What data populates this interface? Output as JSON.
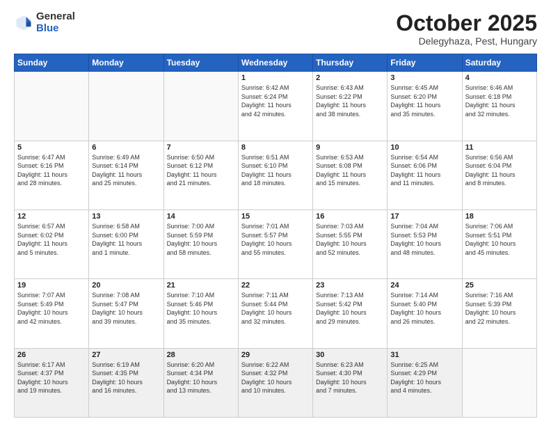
{
  "header": {
    "logo_general": "General",
    "logo_blue": "Blue",
    "month_title": "October 2025",
    "location": "Delegyhaza, Pest, Hungary"
  },
  "weekdays": [
    "Sunday",
    "Monday",
    "Tuesday",
    "Wednesday",
    "Thursday",
    "Friday",
    "Saturday"
  ],
  "weeks": [
    [
      {
        "day": "",
        "info": ""
      },
      {
        "day": "",
        "info": ""
      },
      {
        "day": "",
        "info": ""
      },
      {
        "day": "1",
        "info": "Sunrise: 6:42 AM\nSunset: 6:24 PM\nDaylight: 11 hours\nand 42 minutes."
      },
      {
        "day": "2",
        "info": "Sunrise: 6:43 AM\nSunset: 6:22 PM\nDaylight: 11 hours\nand 38 minutes."
      },
      {
        "day": "3",
        "info": "Sunrise: 6:45 AM\nSunset: 6:20 PM\nDaylight: 11 hours\nand 35 minutes."
      },
      {
        "day": "4",
        "info": "Sunrise: 6:46 AM\nSunset: 6:18 PM\nDaylight: 11 hours\nand 32 minutes."
      }
    ],
    [
      {
        "day": "5",
        "info": "Sunrise: 6:47 AM\nSunset: 6:16 PM\nDaylight: 11 hours\nand 28 minutes."
      },
      {
        "day": "6",
        "info": "Sunrise: 6:49 AM\nSunset: 6:14 PM\nDaylight: 11 hours\nand 25 minutes."
      },
      {
        "day": "7",
        "info": "Sunrise: 6:50 AM\nSunset: 6:12 PM\nDaylight: 11 hours\nand 21 minutes."
      },
      {
        "day": "8",
        "info": "Sunrise: 6:51 AM\nSunset: 6:10 PM\nDaylight: 11 hours\nand 18 minutes."
      },
      {
        "day": "9",
        "info": "Sunrise: 6:53 AM\nSunset: 6:08 PM\nDaylight: 11 hours\nand 15 minutes."
      },
      {
        "day": "10",
        "info": "Sunrise: 6:54 AM\nSunset: 6:06 PM\nDaylight: 11 hours\nand 11 minutes."
      },
      {
        "day": "11",
        "info": "Sunrise: 6:56 AM\nSunset: 6:04 PM\nDaylight: 11 hours\nand 8 minutes."
      }
    ],
    [
      {
        "day": "12",
        "info": "Sunrise: 6:57 AM\nSunset: 6:02 PM\nDaylight: 11 hours\nand 5 minutes."
      },
      {
        "day": "13",
        "info": "Sunrise: 6:58 AM\nSunset: 6:00 PM\nDaylight: 11 hours\nand 1 minute."
      },
      {
        "day": "14",
        "info": "Sunrise: 7:00 AM\nSunset: 5:59 PM\nDaylight: 10 hours\nand 58 minutes."
      },
      {
        "day": "15",
        "info": "Sunrise: 7:01 AM\nSunset: 5:57 PM\nDaylight: 10 hours\nand 55 minutes."
      },
      {
        "day": "16",
        "info": "Sunrise: 7:03 AM\nSunset: 5:55 PM\nDaylight: 10 hours\nand 52 minutes."
      },
      {
        "day": "17",
        "info": "Sunrise: 7:04 AM\nSunset: 5:53 PM\nDaylight: 10 hours\nand 48 minutes."
      },
      {
        "day": "18",
        "info": "Sunrise: 7:06 AM\nSunset: 5:51 PM\nDaylight: 10 hours\nand 45 minutes."
      }
    ],
    [
      {
        "day": "19",
        "info": "Sunrise: 7:07 AM\nSunset: 5:49 PM\nDaylight: 10 hours\nand 42 minutes."
      },
      {
        "day": "20",
        "info": "Sunrise: 7:08 AM\nSunset: 5:47 PM\nDaylight: 10 hours\nand 39 minutes."
      },
      {
        "day": "21",
        "info": "Sunrise: 7:10 AM\nSunset: 5:46 PM\nDaylight: 10 hours\nand 35 minutes."
      },
      {
        "day": "22",
        "info": "Sunrise: 7:11 AM\nSunset: 5:44 PM\nDaylight: 10 hours\nand 32 minutes."
      },
      {
        "day": "23",
        "info": "Sunrise: 7:13 AM\nSunset: 5:42 PM\nDaylight: 10 hours\nand 29 minutes."
      },
      {
        "day": "24",
        "info": "Sunrise: 7:14 AM\nSunset: 5:40 PM\nDaylight: 10 hours\nand 26 minutes."
      },
      {
        "day": "25",
        "info": "Sunrise: 7:16 AM\nSunset: 5:39 PM\nDaylight: 10 hours\nand 22 minutes."
      }
    ],
    [
      {
        "day": "26",
        "info": "Sunrise: 6:17 AM\nSunset: 4:37 PM\nDaylight: 10 hours\nand 19 minutes."
      },
      {
        "day": "27",
        "info": "Sunrise: 6:19 AM\nSunset: 4:35 PM\nDaylight: 10 hours\nand 16 minutes."
      },
      {
        "day": "28",
        "info": "Sunrise: 6:20 AM\nSunset: 4:34 PM\nDaylight: 10 hours\nand 13 minutes."
      },
      {
        "day": "29",
        "info": "Sunrise: 6:22 AM\nSunset: 4:32 PM\nDaylight: 10 hours\nand 10 minutes."
      },
      {
        "day": "30",
        "info": "Sunrise: 6:23 AM\nSunset: 4:30 PM\nDaylight: 10 hours\nand 7 minutes."
      },
      {
        "day": "31",
        "info": "Sunrise: 6:25 AM\nSunset: 4:29 PM\nDaylight: 10 hours\nand 4 minutes."
      },
      {
        "day": "",
        "info": ""
      }
    ]
  ]
}
